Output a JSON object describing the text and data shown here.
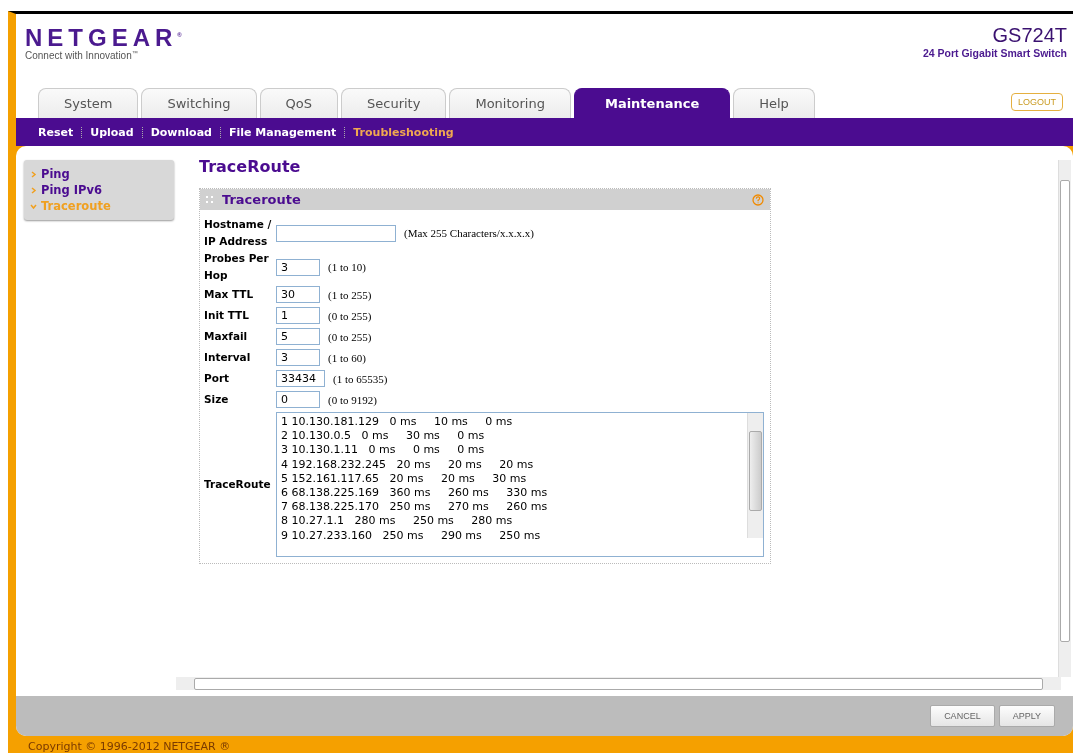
{
  "brand": {
    "logo": "NETGEAR",
    "registered": "®",
    "tagline": "Connect with Innovation",
    "tm": "™"
  },
  "product": {
    "model": "GS724T",
    "description": "24 Port Gigabit Smart Switch"
  },
  "tabs": [
    {
      "label": "System",
      "selected": false
    },
    {
      "label": "Switching",
      "selected": false
    },
    {
      "label": "QoS",
      "selected": false
    },
    {
      "label": "Security",
      "selected": false
    },
    {
      "label": "Monitoring",
      "selected": false
    },
    {
      "label": "Maintenance",
      "selected": true
    },
    {
      "label": "Help",
      "selected": false
    }
  ],
  "logout": "LOGOUT",
  "subnav": [
    {
      "label": "Reset",
      "selected": false
    },
    {
      "label": "Upload",
      "selected": false
    },
    {
      "label": "Download",
      "selected": false
    },
    {
      "label": "File Management",
      "selected": false
    },
    {
      "label": "Troubleshooting",
      "selected": true
    }
  ],
  "sidebar": {
    "items": [
      {
        "label": "Ping",
        "selected": false
      },
      {
        "label": "Ping IPv6",
        "selected": false
      },
      {
        "label": "Traceroute",
        "selected": true
      }
    ]
  },
  "page_title": "TraceRoute",
  "panel": {
    "title": "Traceroute",
    "fields": [
      {
        "label": "Hostname / IP Address",
        "hint": "(Max 255 Characters/x.x.x.x)"
      },
      {
        "label": "Probes Per Hop",
        "value": "3",
        "hint": "(1 to 10)"
      },
      {
        "label": "Max TTL",
        "value": "30",
        "hint": "(1 to 255)"
      },
      {
        "label": "Init TTL",
        "value": "1",
        "hint": "(0 to 255)"
      },
      {
        "label": "Maxfail",
        "value": "5",
        "hint": "(0 to 255)"
      },
      {
        "label": "Interval",
        "value": "3",
        "hint": "(1 to 60)"
      },
      {
        "label": "Port",
        "value": "33434",
        "hint": "(1 to 65535)"
      },
      {
        "label": "Size",
        "value": "0",
        "hint": "(0 to 9192)"
      }
    ],
    "output": {
      "label": "TraceRoute",
      "lines": [
        "1 10.130.181.129   0 ms     10 ms     0 ms",
        "2 10.130.0.5   0 ms     30 ms     0 ms",
        "3 10.130.1.11   0 ms     0 ms     0 ms",
        "4 192.168.232.245   20 ms     20 ms     20 ms",
        "5 152.161.117.65   20 ms     20 ms     30 ms",
        "6 68.138.225.169   360 ms     260 ms     330 ms",
        "7 68.138.225.170   250 ms     270 ms     260 ms",
        "8 10.27.1.1   280 ms     250 ms     280 ms",
        "9 10.27.233.160   250 ms     290 ms     250 ms"
      ]
    }
  },
  "buttons": [
    "CANCEL",
    "APPLY"
  ],
  "copyright": "Copyright © 1996-2012 NETGEAR ®"
}
